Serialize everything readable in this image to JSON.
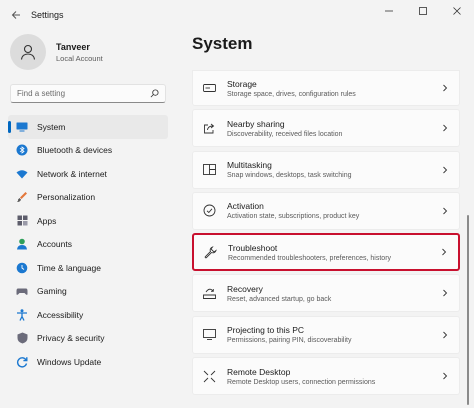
{
  "window": {
    "title": "Settings"
  },
  "profile": {
    "name": "Tanveer",
    "account": "Local Account"
  },
  "search": {
    "placeholder": "Find a setting"
  },
  "nav": {
    "items": [
      {
        "label": "System",
        "icon": "monitor-icon",
        "active": true
      },
      {
        "label": "Bluetooth & devices",
        "icon": "bluetooth-icon"
      },
      {
        "label": "Network & internet",
        "icon": "wifi-icon"
      },
      {
        "label": "Personalization",
        "icon": "paint-brush-icon"
      },
      {
        "label": "Apps",
        "icon": "apps-icon"
      },
      {
        "label": "Accounts",
        "icon": "person-icon"
      },
      {
        "label": "Time & language",
        "icon": "globe-clock-icon"
      },
      {
        "label": "Gaming",
        "icon": "gamepad-icon"
      },
      {
        "label": "Accessibility",
        "icon": "accessibility-icon"
      },
      {
        "label": "Privacy & security",
        "icon": "shield-icon"
      },
      {
        "label": "Windows Update",
        "icon": "update-icon"
      }
    ]
  },
  "main": {
    "title": "System",
    "items": [
      {
        "title": "Storage",
        "desc": "Storage space, drives, configuration rules",
        "icon": "storage-icon"
      },
      {
        "title": "Nearby sharing",
        "desc": "Discoverability, received files location",
        "icon": "share-icon"
      },
      {
        "title": "Multitasking",
        "desc": "Snap windows, desktops, task switching",
        "icon": "multitasking-icon"
      },
      {
        "title": "Activation",
        "desc": "Activation state, subscriptions, product key",
        "icon": "activation-icon"
      },
      {
        "title": "Troubleshoot",
        "desc": "Recommended troubleshooters, preferences, history",
        "icon": "wrench-icon",
        "highlighted": true
      },
      {
        "title": "Recovery",
        "desc": "Reset, advanced startup, go back",
        "icon": "recovery-icon"
      },
      {
        "title": "Projecting to this PC",
        "desc": "Permissions, pairing PIN, discoverability",
        "icon": "projector-icon"
      },
      {
        "title": "Remote Desktop",
        "desc": "Remote Desktop users, connection permissions",
        "icon": "remote-desktop-icon"
      }
    ]
  },
  "colors": {
    "accent": "#0067c0",
    "highlight_border": "#c8102e"
  }
}
